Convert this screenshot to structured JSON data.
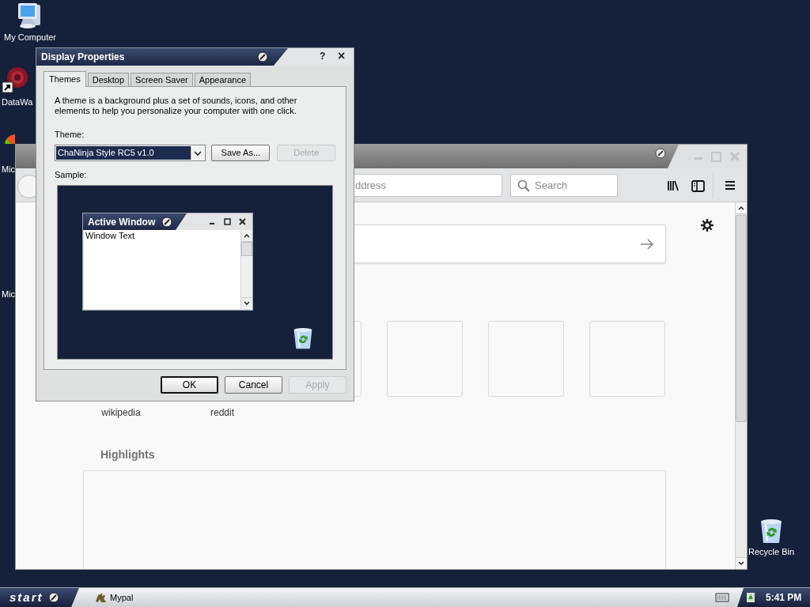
{
  "desktop_icons": [
    {
      "label": "My Computer",
      "kind": "computer"
    },
    {
      "label": "DataWa",
      "kind": "shortcut"
    },
    {
      "label": "Mic",
      "kind": "app"
    },
    {
      "label": "Mic",
      "kind": "blank"
    },
    {
      "label": "Recycle Bin",
      "kind": "recycle"
    }
  ],
  "browser": {
    "address_placeholder": "ddress",
    "search_placeholder": "Search",
    "top_sites": [
      "wikipedia",
      "reddit"
    ],
    "highlights_heading": "Highlights"
  },
  "dialog": {
    "title": "Display Properties",
    "help": "?",
    "close": "×",
    "tabs": [
      {
        "label": "Themes",
        "selected": true
      },
      {
        "label": "Desktop",
        "selected": false
      },
      {
        "label": "Screen Saver",
        "selected": false
      },
      {
        "label": "Appearance",
        "selected": false
      }
    ],
    "description": "A theme is a background plus a set of sounds, icons, and other elements to help you personalize your computer with one click.",
    "theme_label": "Theme:",
    "theme_value": "ChaNinja Style RC5 v1.0",
    "side_buttons": [
      {
        "label": "Save As...",
        "disabled": false
      },
      {
        "label": "Delete",
        "disabled": true
      }
    ],
    "sample_label": "Sample:",
    "sample": {
      "title": "Active Window",
      "text": "Window Text"
    },
    "buttons": [
      {
        "label": "OK",
        "default": true,
        "disabled": false
      },
      {
        "label": "Cancel",
        "default": false,
        "disabled": false
      },
      {
        "label": "Apply",
        "default": false,
        "disabled": true
      }
    ]
  },
  "taskbar": {
    "start": "start",
    "items": [
      {
        "label": "Mypal"
      }
    ],
    "clock": "5:41 PM"
  }
}
